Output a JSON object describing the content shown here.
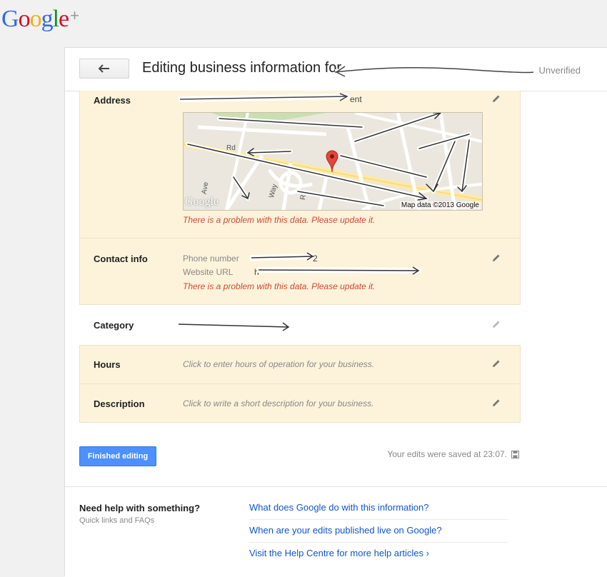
{
  "brand": {
    "logo_letters": [
      "G",
      "o",
      "o",
      "g",
      "l",
      "e"
    ],
    "logo_colors": [
      "#3369e8",
      "#d50f25",
      "#eeb211",
      "#3369e8",
      "#009925",
      "#d50f25"
    ],
    "plus": "+"
  },
  "header": {
    "title": "Editing business information for",
    "status": "Unverified"
  },
  "sections": {
    "address": {
      "label": "Address",
      "value_end": "ent",
      "map_credit": "Map data ©2013 Google",
      "map_logo": "Google",
      "map_streets": [
        "Rd",
        "Rd",
        "Way",
        "Ave"
      ],
      "error": "There is a problem with this data. Please update it."
    },
    "contact": {
      "label": "Contact info",
      "phone_label": "Phone number",
      "phone_value_end": "2",
      "url_label": "Website URL",
      "url_value_start": "h",
      "error": "There is a problem with this data. Please update it."
    },
    "category": {
      "label": "Category"
    },
    "hours": {
      "label": "Hours",
      "placeholder": "Click to enter hours of operation for your business."
    },
    "description": {
      "label": "Description",
      "placeholder": "Click to write a short description for your business."
    }
  },
  "footer": {
    "finish_label": "Finished editing",
    "saved_text": "Your edits were saved at 23:07."
  },
  "help": {
    "title": "Need help with something?",
    "subtitle": "Quick links and FAQs",
    "links": [
      "What does Google do with this information?",
      "When are your edits published live on Google?",
      "Visit the Help Centre for more help articles ›"
    ]
  },
  "colors": {
    "accent": "#4d90fe",
    "error": "#d14836",
    "link": "#1155cc",
    "section_bg": "#fcf3da"
  },
  "icons": [
    "back-arrow-icon",
    "pencil-icon",
    "map-pin-icon",
    "floppy-disk-icon"
  ]
}
